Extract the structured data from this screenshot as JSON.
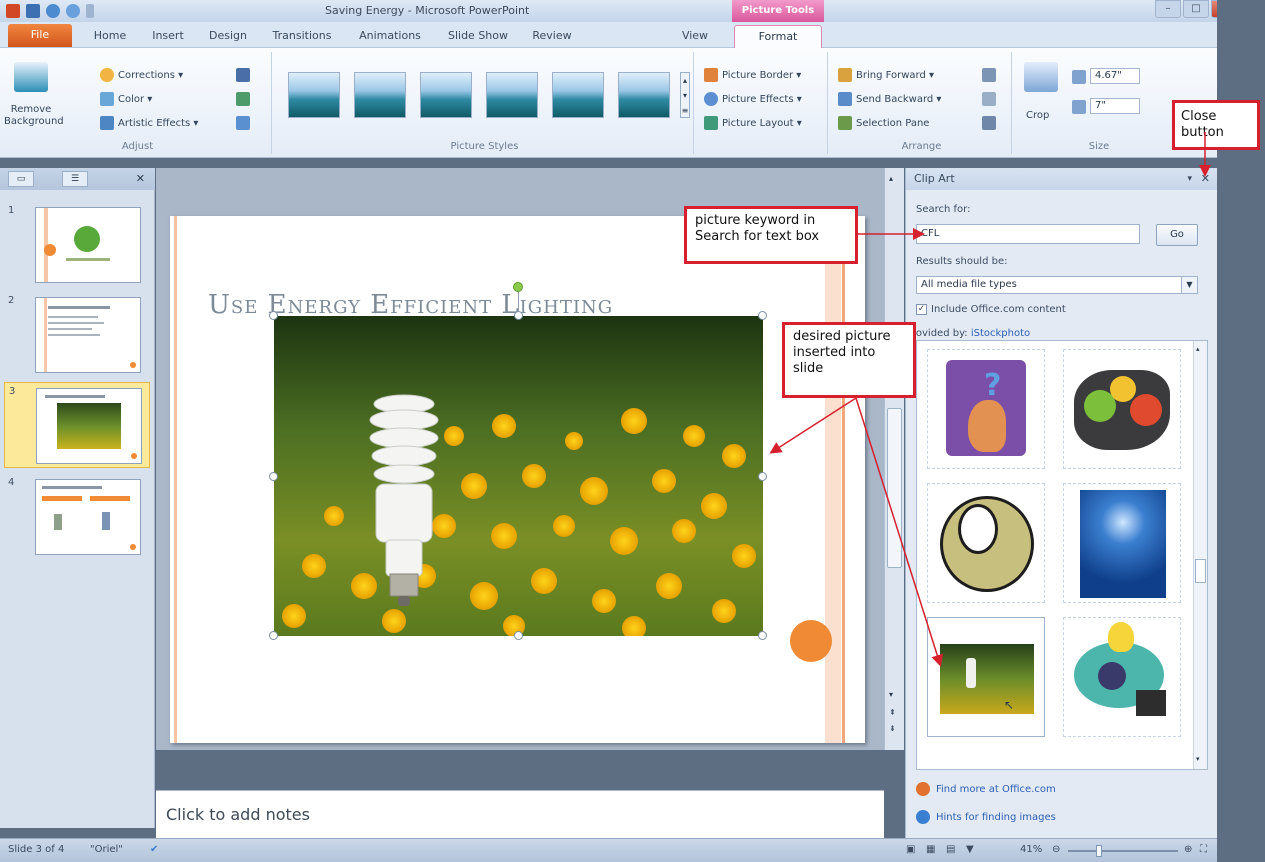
{
  "window": {
    "title": "Saving Energy - Microsoft PowerPoint",
    "context_tab": "Picture Tools",
    "controls": {
      "minimize": "–",
      "maximize": "□",
      "close": "✕"
    }
  },
  "tabs": [
    "File",
    "Home",
    "Insert",
    "Design",
    "Transitions",
    "Animations",
    "Slide Show",
    "Review",
    "View",
    "Format"
  ],
  "ribbon": {
    "adjust": {
      "remove_background": "Remove Background",
      "corrections": "Corrections ▾",
      "color": "Color ▾",
      "artistic_effects": "Artistic Effects ▾",
      "label": "Adjust"
    },
    "picture_styles": {
      "label": "Picture Styles",
      "picture_border": "Picture Border ▾",
      "picture_effects": "Picture Effects ▾",
      "picture_layout": "Picture Layout ▾"
    },
    "arrange": {
      "label": "Arrange",
      "bring_forward": "Bring Forward ▾",
      "send_backward": "Send Backward ▾",
      "selection_pane": "Selection Pane"
    },
    "size": {
      "label": "Size",
      "crop": "Crop",
      "height": "4.67\"",
      "width": "7\""
    }
  },
  "thumbnails": {
    "slides": [
      "1",
      "2",
      "3",
      "4"
    ],
    "selected": 3
  },
  "slide": {
    "title": "Use Energy Efficient Lighting",
    "notes_placeholder": "Click to add notes"
  },
  "clip_art": {
    "title": "Clip Art",
    "search_for_label": "Search for:",
    "search_value": "CFL",
    "go_button": "Go",
    "results_label": "Results should be:",
    "results_value": "All media file types",
    "include_office": "Include Office.com content",
    "provided_by_label": "rovided by:",
    "provided_by_value": "iStockphoto",
    "find_more": "Find more at Office.com",
    "hints": "Hints for finding images"
  },
  "status": {
    "slide_of": "Slide 3 of 4",
    "theme": "\"Oriel\"",
    "zoom": "41%"
  },
  "callouts": {
    "close_button": "Close button",
    "picture_keyword": "picture keyword in Search for text box",
    "desired_picture": "desired picture inserted into slide"
  },
  "colors": {
    "file_tab": "#d2571c",
    "context_tab": "#d9579c",
    "callout_border": "#d6202d",
    "slide_accent": "#f08a34"
  }
}
